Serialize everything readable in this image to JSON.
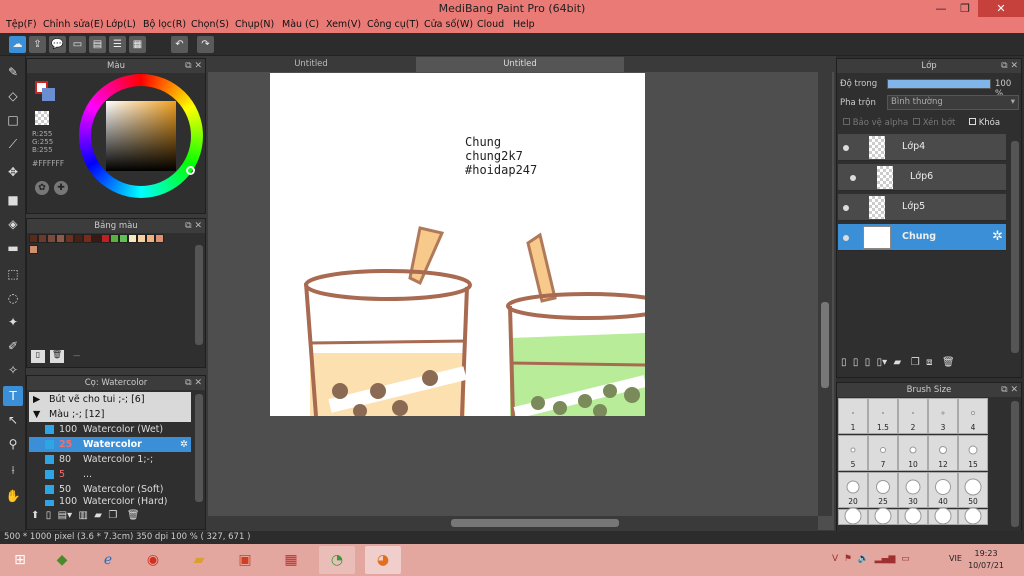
{
  "window": {
    "title": "MediBang Paint Pro (64bit)",
    "controls": {
      "minimize": "—",
      "maximize": "❐",
      "close": "✕"
    }
  },
  "menu": [
    "Tệp(F)",
    "Chỉnh sửa(E)",
    "Lớp(L)",
    "Bộ lọc(R)",
    "Chọn(S)",
    "Chụp(N)",
    "Màu (C)",
    "Xem(V)",
    "Công cụ(T)",
    "Cửa số(W)",
    "Cloud",
    "Help"
  ],
  "color_panel": {
    "title": "Màu",
    "r": "R:255",
    "g": "G:255",
    "b": "B:255",
    "hex": "#FFFFFF",
    "colors": {
      "primary": "#ffffff",
      "secondary": "#6a8ed0",
      "accent": "#3b8fd6"
    }
  },
  "palette_panel": {
    "title": "Bảng màu",
    "colors": [
      "#5a2a1a",
      "#6b3a2a",
      "#7b4a3a",
      "#8b5a4a",
      "#6a3020",
      "#4a2010",
      "#7a2a1a",
      "#3a1a10",
      "#c02020",
      "#5ab040",
      "#60c050",
      "#f8e8c0",
      "#f8d0a0",
      "#f0b080",
      "#e09070"
    ],
    "extra": "#d09070",
    "footer": "—"
  },
  "brush_panel": {
    "title": "Cọ: Watercolor",
    "groups": [
      {
        "label": "Bút vẽ cho tui ;-; [6]",
        "open": false
      },
      {
        "label": "Màu ;-; [12]",
        "open": true
      }
    ],
    "items": [
      {
        "size": "100",
        "name": "Watercolor (Wet)"
      },
      {
        "size": "25",
        "name": "Watercolor",
        "selected": true
      },
      {
        "size": "80",
        "name": "Watercolor 1;-;"
      },
      {
        "size": "5",
        "name": "..."
      },
      {
        "size": "50",
        "name": "Watercolor (Soft)"
      },
      {
        "size": "100",
        "name": "Watercolor (Hard)"
      }
    ]
  },
  "tabs": [
    "Untitled",
    "Untitled"
  ],
  "canvas": {
    "note_lines": "Chung\nchung2k7\n#hoidap247"
  },
  "layer_panel": {
    "title": "Lớp",
    "opacity_label": "Độ trong",
    "opacity_value": "100 %",
    "opacity_fraction": 1.0,
    "blend_label": "Pha trộn",
    "blend_value": "Bình thường",
    "protect_alpha": "Bảo vệ alpha",
    "clipping": "Xén bớt",
    "lock": "Khóa",
    "layers": [
      {
        "name": "Lớp4",
        "selected": false
      },
      {
        "name": "Lớp6",
        "selected": false
      },
      {
        "name": "Lớp5",
        "selected": false
      },
      {
        "name": "Chung",
        "selected": true
      }
    ]
  },
  "brush_size_panel": {
    "title": "Brush Size",
    "sizes": [
      "1",
      "1.5",
      "2",
      "3",
      "4",
      "5",
      "7",
      "10",
      "12",
      "15",
      "20",
      "25",
      "30",
      "40",
      "50",
      "",
      "",
      "",
      "",
      ""
    ]
  },
  "status": {
    "text": "500 * 1000 pixel  (3.6 * 7.3cm)  350 dpi  100 %  ( 327, 671 )"
  },
  "taskbar": {
    "lang": "VIE",
    "time": "19:23",
    "date": "10/07/21"
  }
}
